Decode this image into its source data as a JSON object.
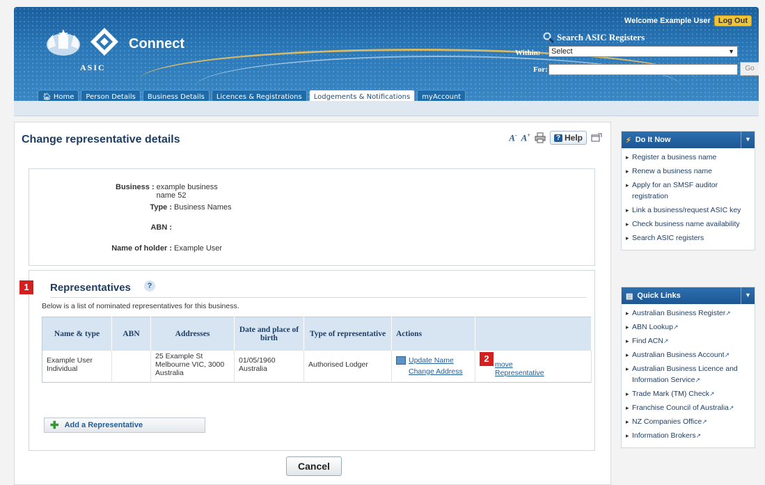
{
  "header": {
    "logo_text": "Connect",
    "logo_sub": "ASIC",
    "welcome_text": "Welcome Example User",
    "logout_label": "Log Out",
    "search_title": "Search ASIC Registers",
    "within_label": "Within:",
    "within_value": "Select",
    "for_label": "For:",
    "go_label": "Go"
  },
  "tabs": [
    {
      "label": "Home"
    },
    {
      "label": "Person Details"
    },
    {
      "label": "Business Details"
    },
    {
      "label": "Licences & Registrations"
    },
    {
      "label": "Lodgements & Notifications"
    },
    {
      "label": "myAccount"
    }
  ],
  "page": {
    "title": "Change representative details",
    "help_label": "Help"
  },
  "details": {
    "business_label": "Business :",
    "business_value": "example business name 52",
    "type_label": "Type :",
    "type_value": "Business Names",
    "abn_label": "ABN :",
    "abn_value": "",
    "holder_label": "Name of holder :",
    "holder_value": "Example User"
  },
  "representatives": {
    "marker": "1",
    "title": "Representatives",
    "help": "?",
    "description": "Below is a list of nominated representatives for this business.",
    "columns": [
      "Name & type",
      "ABN",
      "Addresses",
      "Date and place of birth",
      "Type of representative",
      "Actions",
      ""
    ],
    "row": {
      "name": "Example User",
      "type": "Individual",
      "abn": "",
      "address_1": "25 Example St",
      "address_2": "Melbourne VIC, 3000",
      "address_3": "Australia",
      "dob": "01/05/1960",
      "pob": "Australia",
      "rep_type": "Authorised Lodger",
      "action_update": "Update Name",
      "action_address": "Change Address",
      "action_remove_1": "move",
      "action_remove_2": "Representative",
      "marker": "2"
    },
    "add_label": "Add a Representative",
    "cancel_label": "Cancel"
  },
  "do_it_now": {
    "title": "Do It Now",
    "items": [
      "Register a business name",
      "Renew a business name",
      "Apply for an SMSF auditor registration",
      "Link a business/request ASIC key",
      "Check business name availability",
      "Search ASIC registers"
    ]
  },
  "quick_links": {
    "title": "Quick Links",
    "items": [
      "Australian Business Register",
      "ABN Lookup",
      "Find ACN",
      "Australian Business Account",
      "Australian Business Licence and Information Service",
      "Trade Mark (TM) Check",
      "Franchise Council of Australia",
      "NZ Companies Office",
      "Information Brokers"
    ]
  }
}
